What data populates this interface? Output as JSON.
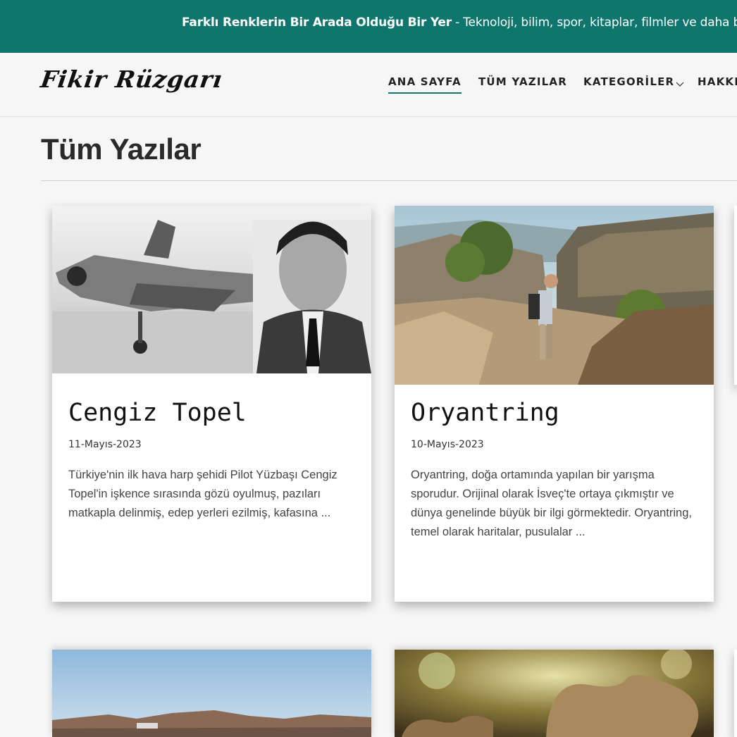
{
  "announcement": {
    "bold": "Farklı Renklerin Bir Arada Olduğu Bir Yer",
    "rest": " - Teknoloji, bilim, spor, kitaplar, filmler ve daha bir çok k"
  },
  "header": {
    "logo": "Fikir Rüzgarı",
    "nav": [
      {
        "label": "ANA SAYFA",
        "active": true
      },
      {
        "label": "TÜM YAZILAR",
        "active": false
      },
      {
        "label": "KATEGORİLER",
        "active": false
      },
      {
        "label": "HAKKIN",
        "active": false
      }
    ]
  },
  "page": {
    "title": "Tüm Yazılar"
  },
  "posts": [
    {
      "title": "Cengiz Topel",
      "date": "11-Mayıs-2023",
      "excerpt": "Türkiye'nin ilk hava harp şehidi Pilot Yüzbaşı Cengiz Topel'in işkence sırasında gözü oyulmuş, pazıları matkapla delinmiş, edep yerleri ezilmiş, kafasına ..."
    },
    {
      "title": "Oryantring",
      "date": "10-Mayıs-2023",
      "excerpt": "Oryantring, doğa ortamında yapılan bir yarışma sporudur. Orijinal olarak İsveç'te ortaya çıkmıştır ve dünya genelinde büyük bir ilgi görmektedir. Oryantring, temel olarak haritalar, pusulalar ..."
    }
  ],
  "colors": {
    "accent": "#0e766d",
    "background": "#f6f6f6"
  },
  "icons": {
    "dropdown": "chevron-down-icon"
  }
}
